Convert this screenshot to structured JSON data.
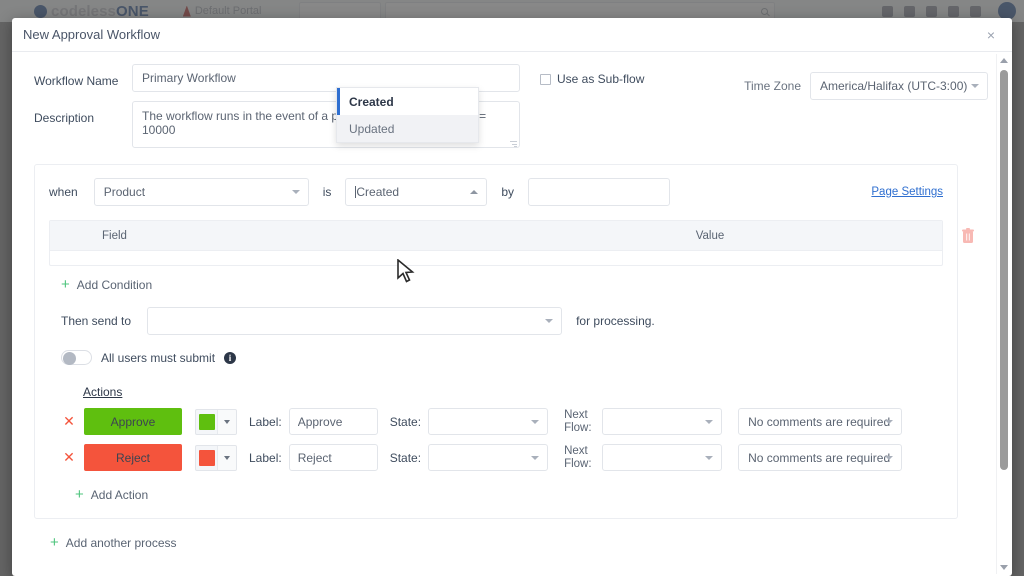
{
  "app": {
    "brand_prefix": "codeless",
    "brand_suffix": "ONE",
    "portal_label": "Default Portal",
    "header_icons": [
      "user-icon",
      "cart-icon",
      "bell-icon",
      "help-icon",
      "upload-icon"
    ],
    "avatar": "avatar"
  },
  "modal": {
    "title": "New Approval Workflow",
    "close_label": "×"
  },
  "form": {
    "workflow_name_label": "Workflow Name",
    "workflow_name_value": "Primary Workflow",
    "workflow_name_placeholder": "Workflow Name",
    "description_label": "Description",
    "description_value": "The workflow runs in the event of a product created with price >= 10000",
    "description_placeholder": "Description",
    "subflow_label": "Use as Sub-flow",
    "subflow_checked": false,
    "timezone_label": "Time Zone",
    "timezone_value": "America/Halifax (UTC-3:00)"
  },
  "process": {
    "when_word": "when",
    "object_value": "Product",
    "is_word": "is",
    "event_value": "Created",
    "by_word": "by",
    "by_value": "",
    "page_settings_link": "Page Settings",
    "event_options": [
      {
        "label": "Created",
        "state": "selected"
      },
      {
        "label": "Updated",
        "state": "hovered"
      }
    ],
    "condition_table": {
      "columns": [
        "Field",
        "Value"
      ],
      "rows": []
    },
    "delete_process_icon": "trash-icon",
    "add_condition_label": "Add Condition",
    "then_send_to_label": "Then send to",
    "then_send_to_value": "",
    "for_processing_label": "for processing.",
    "all_users_must_submit_label": "All users must submit",
    "all_users_must_submit_on": false,
    "info_icon_char": "i",
    "actions_title": "Actions",
    "actions": [
      {
        "button_text": "Approve",
        "color": "#5fbf0f",
        "label_field_label": "Label:",
        "label_value": "Approve",
        "state_field_label": "State:",
        "state_value": "",
        "next_flow_label_line1": "Next",
        "next_flow_label_line2": "Flow:",
        "next_flow_value": "",
        "comments_value": "No comments are required"
      },
      {
        "button_text": "Reject",
        "color": "#f4543c",
        "label_field_label": "Label:",
        "label_value": "Reject",
        "state_field_label": "State:",
        "state_value": "",
        "next_flow_label_line1": "Next",
        "next_flow_label_line2": "Flow:",
        "next_flow_value": "",
        "comments_value": "No comments are required"
      }
    ],
    "add_action_label": "Add Action",
    "add_another_process_label": "Add another process"
  },
  "colors": {
    "accent_link": "#2f6fd0",
    "add_plus_green": "#4ec47d",
    "approve_green": "#5fbf0f",
    "reject_red": "#f4543c",
    "trash_pink": "#f8b9b4",
    "brand_blue": "#1d4a8f"
  }
}
